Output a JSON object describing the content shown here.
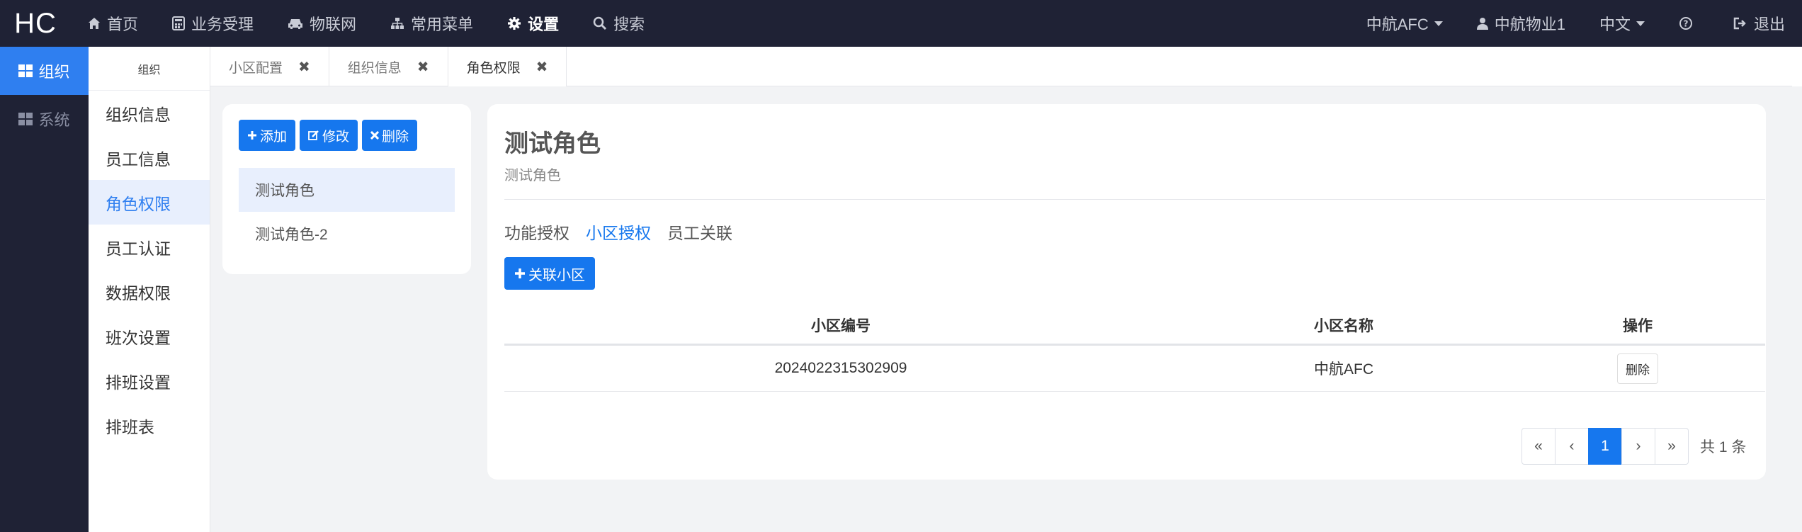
{
  "topbar": {
    "logo": "HC",
    "nav": [
      {
        "label": "首页",
        "icon": "home-icon"
      },
      {
        "label": "业务受理",
        "icon": "calculator-icon"
      },
      {
        "label": "物联网",
        "icon": "car-icon"
      },
      {
        "label": "常用菜单",
        "icon": "sitemap-icon"
      },
      {
        "label": "设置",
        "icon": "gear-icon",
        "active": true
      },
      {
        "label": "搜索",
        "icon": "search-icon"
      }
    ],
    "right": {
      "community": "中航AFC",
      "user": "中航物业1",
      "language": "中文",
      "logout": "退出"
    }
  },
  "leftbar": {
    "items": [
      {
        "label": "组织",
        "active": true
      },
      {
        "label": "系统",
        "active": false
      }
    ]
  },
  "submenu": {
    "header": "组织",
    "items": [
      "组织信息",
      "员工信息",
      "角色权限",
      "员工认证",
      "数据权限",
      "班次设置",
      "排班设置",
      "排班表"
    ],
    "active_index": 2
  },
  "tabs": [
    {
      "label": "小区配置",
      "active": false
    },
    {
      "label": "组织信息",
      "active": false
    },
    {
      "label": "角色权限",
      "active": true
    }
  ],
  "roles_panel": {
    "add": "添加",
    "edit": "修改",
    "delete": "删除",
    "roles": [
      "测试角色",
      "测试角色-2"
    ]
  },
  "detail": {
    "title": "测试角色",
    "subtitle": "测试角色",
    "subtabs": [
      "功能授权",
      "小区授权",
      "员工关联"
    ],
    "active_subtab": 1,
    "link_button": "关联小区",
    "table": {
      "headers": [
        "小区编号",
        "小区名称",
        "操作"
      ],
      "rows": [
        {
          "code": "2024022315302909",
          "name": "中航AFC",
          "action": "删除"
        }
      ]
    },
    "pagination": {
      "first": "«",
      "prev": "‹",
      "current": "1",
      "next": "›",
      "last": "»",
      "total": "共 1 条"
    }
  },
  "colors": {
    "topbar_bg": "#1f2235",
    "primary": "#1677ee",
    "active_bg": "#e8effd"
  }
}
